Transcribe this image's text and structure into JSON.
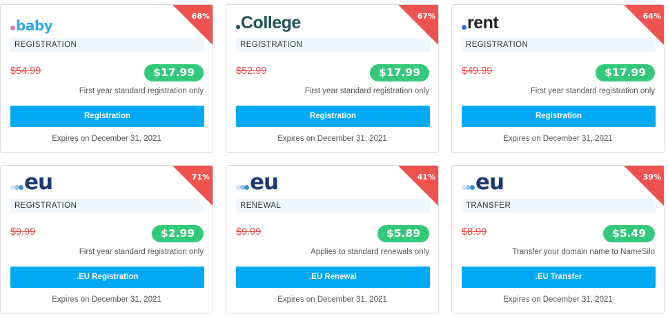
{
  "cards": [
    {
      "discount": "68%",
      "logo": ".baby",
      "label": "REGISTRATION",
      "old_price": "$54.99",
      "price": "$17.99",
      "note": "First year standard registration only",
      "button": "Registration",
      "expires": "Expires on December 31, 2021"
    },
    {
      "discount": "67%",
      "logo": ".College",
      "label": "REGISTRATION",
      "old_price": "$52.99",
      "price": "$17.99",
      "note": "First year standard registration only",
      "button": "Registration",
      "expires": "Expires on December 31, 2021"
    },
    {
      "discount": "64%",
      "logo": ".rent",
      "label": "REGISTRATION",
      "old_price": "$49.99",
      "price": "$17.99",
      "note": "First year standard registration only",
      "button": "Registration",
      "expires": "Expires on December 31, 2021"
    },
    {
      "discount": "71%",
      "logo": ".eu",
      "label": "REGISTRATION",
      "old_price": "$9.99",
      "price": "$2.99",
      "note": "First year standard registration only",
      "button": ".EU Registration",
      "expires": "Expires on December 31, 2021"
    },
    {
      "discount": "41%",
      "logo": ".eu",
      "label": "RENEWAL",
      "old_price": "$9.99",
      "price": "$5.89",
      "note": "Applies to standard renewals only",
      "button": ".EU Renewal",
      "expires": "Expires on December 31, 2021"
    },
    {
      "discount": "39%",
      "logo": ".eu",
      "label": "TRANSFER",
      "old_price": "$8.99",
      "price": "$5.49",
      "note": "Transfer your domain name to NameSilo",
      "button": ".EU Transfer",
      "expires": "Expires on December 31, 2021"
    }
  ],
  "logo_text": {
    "baby": "baby",
    "college": "College",
    "rent": "rent",
    "eu": "eu"
  },
  "colors": {
    "discount": "#ef5350",
    "price_badge": "#33c97a",
    "button": "#03a9f4",
    "old_price": "#e2504c",
    "label_bg": "#eff7fd"
  }
}
